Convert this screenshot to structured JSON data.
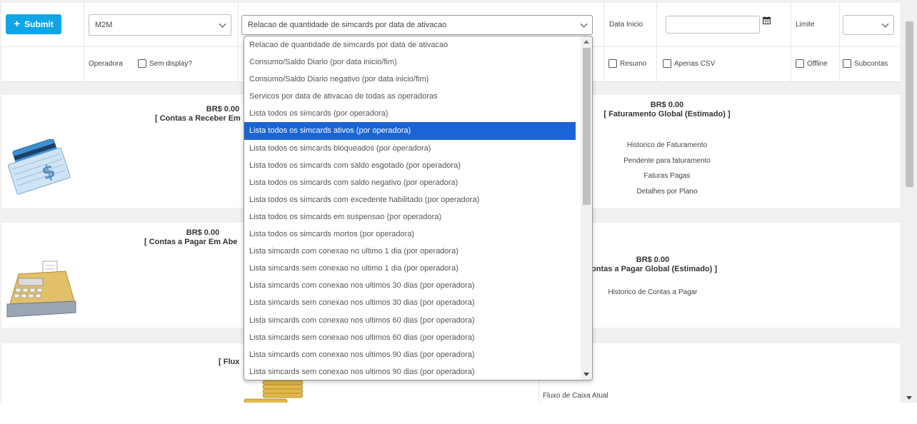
{
  "toolbar": {
    "submit_label": "Submit",
    "account_type": "M2M",
    "report_select": "Relacao de quantidade de simcards por data de ativacao",
    "data_inicio_label": "Data Inicio",
    "limite_label": "Limite",
    "operadora_label": "Operadora",
    "checkboxes": {
      "sem_display": "Sem display?",
      "resumo": "Resumo",
      "apenas_csv": "Apenas CSV",
      "offline": "Offline",
      "subcontas": "Subcontas"
    }
  },
  "panels": {
    "receber": {
      "amount": "BR$ 0.00",
      "title": "[ Contas a Receber Em"
    },
    "faturamento": {
      "amount": "BR$ 0.00",
      "title": "[ Faturamento Global (Estimado) ]",
      "links": [
        "Historico de Faturamento",
        "Pendente para faturamento",
        "Faturas Pagas",
        "Detalhes por Plano"
      ]
    },
    "pagar": {
      "amount": "BR$ 0.00",
      "title": "[ Contas a Pagar Em Abe"
    },
    "pagar_global": {
      "amount": "BR$ 0.00",
      "title": "ontas a Pagar Global (Estimado) ]",
      "link": "Historico de Contas a Pagar"
    },
    "fluxo": {
      "title": "[ Flux",
      "link": "Fluxo de Caixa Atual"
    }
  },
  "dropdown": {
    "selected_index": 5,
    "options": [
      "Relacao de quantidade de simcards por data de ativacao",
      "Consumo/Saldo Diario (por data inicio/fim)",
      "Consumo/Saldo Diario negativo (por data inicio/fim)",
      "Servicos por data de ativacao de todas as operadoras",
      "Lista todos os simcards (por operadora)",
      "Lista todos os simcards ativos (por operadora)",
      "Lista todos os simcards bloqueados (por operadora)",
      "Lista todos os simcards com saldo esgotado (por operadora)",
      "Lista todos os simcards com saldo negativo (por operadora)",
      "Lista todos os simcards com excedente habilitado (por operadora)",
      "Lista todos os simcards em suspensao (por operadora)",
      "Lista todos os simcards mortos (por operadora)",
      "Lista simcards com conexao no ultimo 1 dia (por operadora)",
      "Lista simcards sem conexao no ultimo 1 dia (por operadora)",
      "Lista simcards com conexao nos ultimos 30 dias (por operadora)",
      "Lista simcards sem conexao nos ultimos 30 dias (por operadora)",
      "Lista simcards com conexao nos ultimos 60 dias (por operadora)",
      "Lista simcards sem conexao nos ultimos 60 dias (por operadora)",
      "Lista simcards com conexao nos ultimos 90 dias (por operadora)",
      "Lista simcards sem conexao nos ultimos 90 dias (por operadora)"
    ]
  },
  "colors": {
    "accent": "#0ea5e9",
    "selected": "#1a64d6"
  }
}
